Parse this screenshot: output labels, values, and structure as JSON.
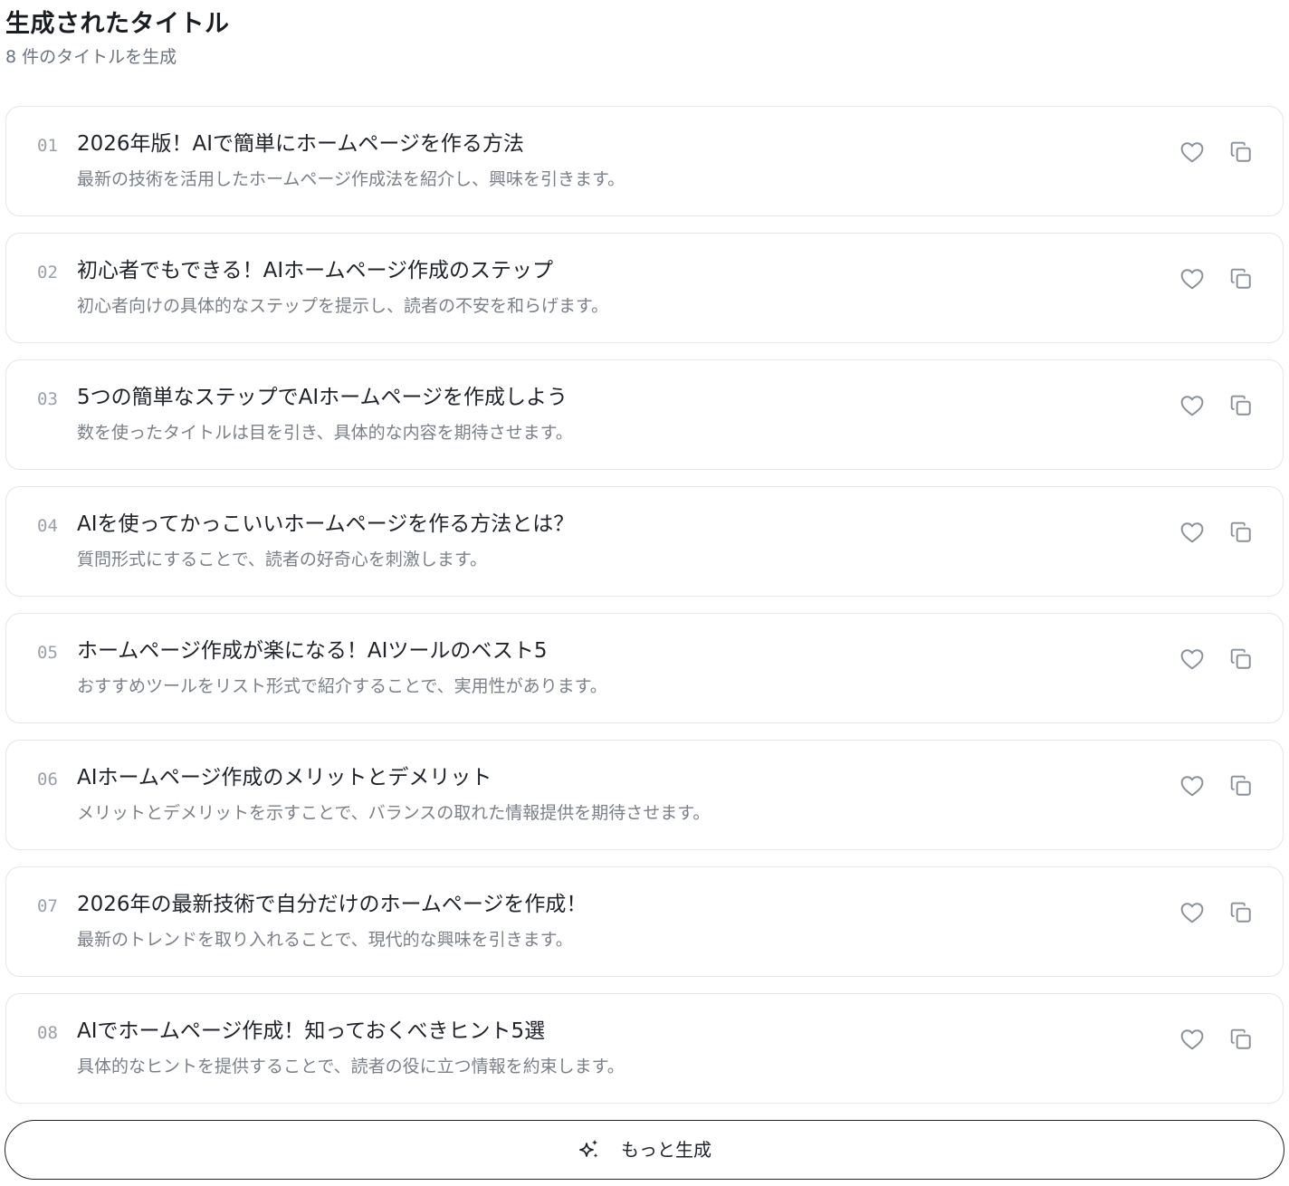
{
  "header": {
    "title": "生成されたタイトル",
    "subtitle": "8 件のタイトルを生成"
  },
  "titles": [
    {
      "num": "01",
      "title": "2026年版！AIで簡単にホームページを作る方法",
      "desc": "最新の技術を活用したホームページ作成法を紹介し、興味を引きます。"
    },
    {
      "num": "02",
      "title": "初心者でもできる！AIホームページ作成のステップ",
      "desc": "初心者向けの具体的なステップを提示し、読者の不安を和らげます。"
    },
    {
      "num": "03",
      "title": "5つの簡単なステップでAIホームページを作成しよう",
      "desc": "数を使ったタイトルは目を引き、具体的な内容を期待させます。"
    },
    {
      "num": "04",
      "title": "AIを使ってかっこいいホームページを作る方法とは？",
      "desc": "質問形式にすることで、読者の好奇心を刺激します。"
    },
    {
      "num": "05",
      "title": "ホームページ作成が楽になる！AIツールのベスト5",
      "desc": "おすすめツールをリスト形式で紹介することで、実用性があります。"
    },
    {
      "num": "06",
      "title": "AIホームページ作成のメリットとデメリット",
      "desc": "メリットとデメリットを示すことで、バランスの取れた情報提供を期待させます。"
    },
    {
      "num": "07",
      "title": "2026年の最新技術で自分だけのホームページを作成！",
      "desc": "最新のトレンドを取り入れることで、現代的な興味を引きます。"
    },
    {
      "num": "08",
      "title": "AIでホームページ作成！知っておくべきヒント5選",
      "desc": "具体的なヒントを提供することで、読者の役に立つ情報を約束します。"
    }
  ],
  "icons": {
    "like": "heart-icon",
    "copy": "copy-icon",
    "generate": "sparkles-icon"
  },
  "more_button": {
    "label": "もっと生成"
  },
  "colors": {
    "text": "#1f2329",
    "muted": "#7b8088",
    "number": "#9aa0a8",
    "border": "#e4e6ea",
    "icon": "#8a9099"
  }
}
